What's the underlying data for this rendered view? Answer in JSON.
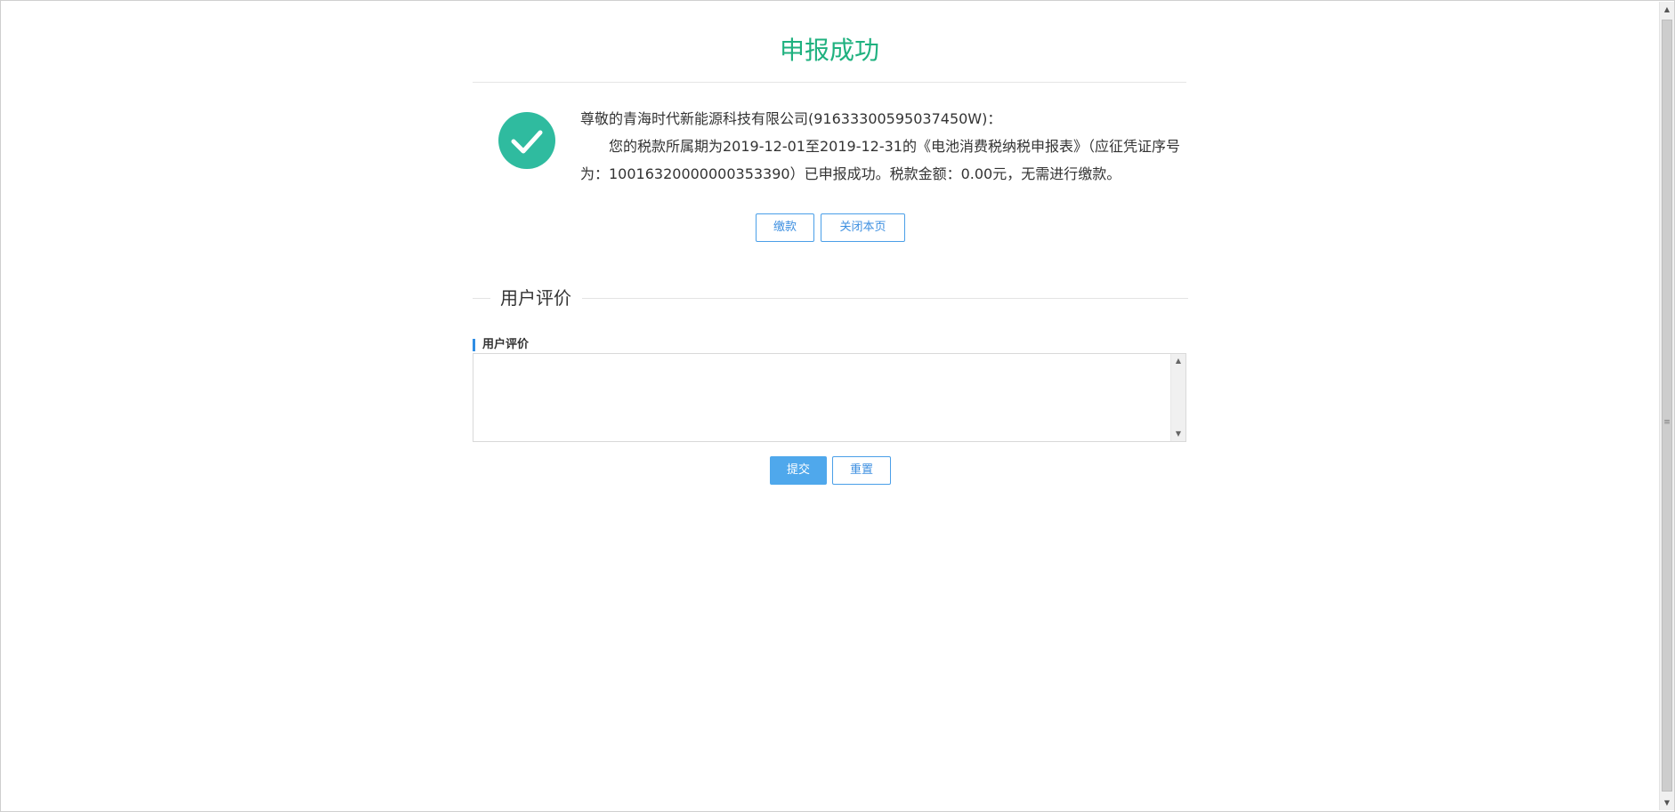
{
  "page": {
    "title": "申报成功",
    "title_color": "#1fb17f"
  },
  "result": {
    "icon": "check-circle-icon",
    "icon_color": "#2fbb9f",
    "greeting": "尊敬的青海时代新能源科技有限公司(91633300595037450W)：",
    "body": "您的税款所属期为2019-12-01至2019-12-31的《电池消费税纳税申报表》（应征凭证序号为：10016320000000353390）已申报成功。税款金额：0.00元，无需进行缴款。"
  },
  "actions": {
    "pay_label": "缴款",
    "close_label": "关闭本页"
  },
  "evaluation": {
    "section_title": "用户评价",
    "field_label": "用户评价",
    "textarea_value": "",
    "submit_label": "提交",
    "reset_label": "重置",
    "primary_color": "#4fa8ec"
  },
  "scrollbar": {
    "up_icon": "▲",
    "down_icon": "▼",
    "grip_icon": "≡"
  }
}
